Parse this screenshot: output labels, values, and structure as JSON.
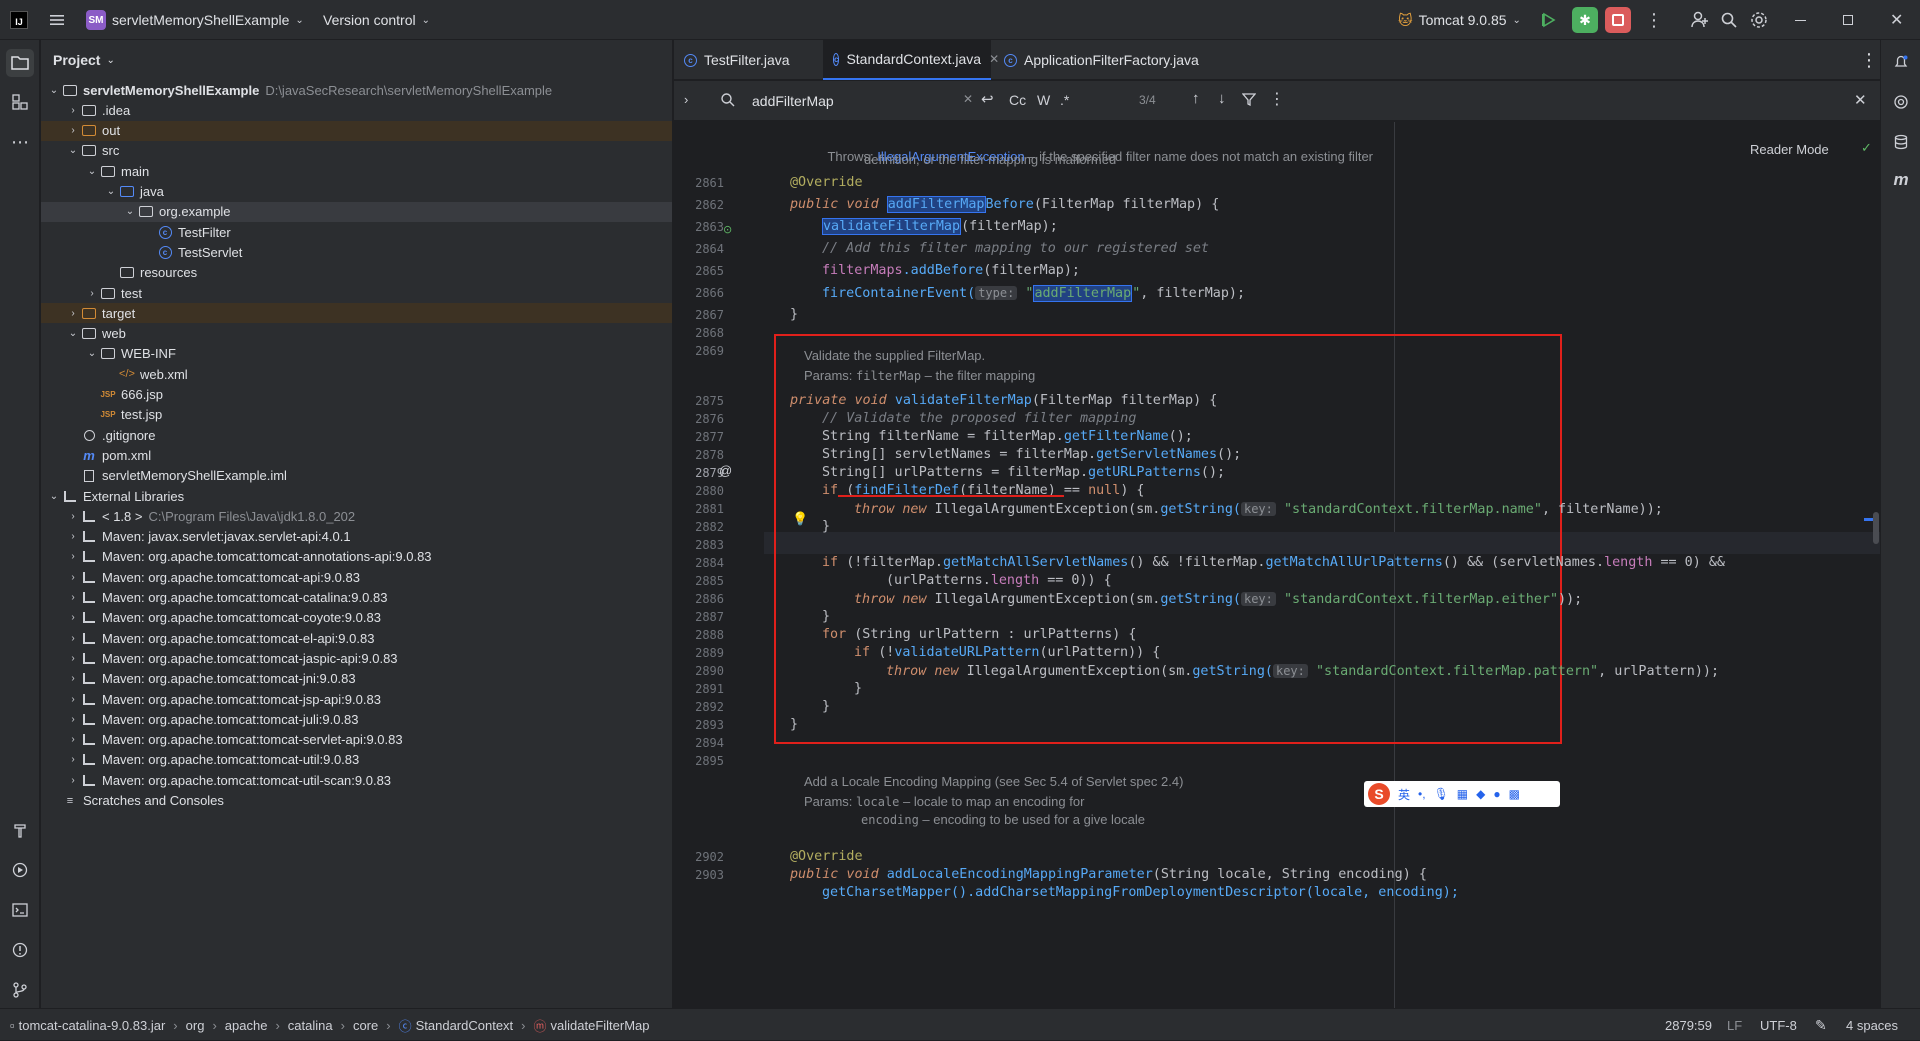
{
  "titlebar": {
    "project_badge": "SM",
    "project_name": "servletMemoryShellExample",
    "vcs": "Version control",
    "run_config": "Tomcat 9.0.85"
  },
  "project_panel": {
    "title": "Project",
    "tree": [
      {
        "label": "servletMemoryShellExample",
        "extra": "D:\\javaSecResearch\\servletMemoryShellExample",
        "depth": 0,
        "arrow": "down",
        "icon": "module",
        "bold": true
      },
      {
        "label": ".idea",
        "depth": 1,
        "arrow": "right",
        "icon": "folder"
      },
      {
        "label": "out",
        "depth": 1,
        "arrow": "right",
        "icon": "folder-orange",
        "excluded": true
      },
      {
        "label": "src",
        "depth": 1,
        "arrow": "down",
        "icon": "folder"
      },
      {
        "label": "main",
        "depth": 2,
        "arrow": "down",
        "icon": "folder"
      },
      {
        "label": "java",
        "depth": 3,
        "arrow": "down",
        "icon": "folder-blue"
      },
      {
        "label": "org.example",
        "depth": 4,
        "arrow": "down",
        "icon": "package",
        "selected": true
      },
      {
        "label": "TestFilter",
        "depth": 5,
        "arrow": "",
        "icon": "class"
      },
      {
        "label": "TestServlet",
        "depth": 5,
        "arrow": "",
        "icon": "class"
      },
      {
        "label": "resources",
        "depth": 3,
        "arrow": "",
        "icon": "folder"
      },
      {
        "label": "test",
        "depth": 2,
        "arrow": "right",
        "icon": "folder"
      },
      {
        "label": "target",
        "depth": 1,
        "arrow": "right",
        "icon": "folder-orange",
        "excluded": true
      },
      {
        "label": "web",
        "depth": 1,
        "arrow": "down",
        "icon": "folder"
      },
      {
        "label": "WEB-INF",
        "depth": 2,
        "arrow": "down",
        "icon": "folder"
      },
      {
        "label": "web.xml",
        "depth": 3,
        "arrow": "",
        "icon": "xml"
      },
      {
        "label": "666.jsp",
        "depth": 2,
        "arrow": "",
        "icon": "jsp"
      },
      {
        "label": "test.jsp",
        "depth": 2,
        "arrow": "",
        "icon": "jsp"
      },
      {
        "label": ".gitignore",
        "depth": 1,
        "arrow": "",
        "icon": "ignore"
      },
      {
        "label": "pom.xml",
        "depth": 1,
        "arrow": "",
        "icon": "maven"
      },
      {
        "label": "servletMemoryShellExample.iml",
        "depth": 1,
        "arrow": "",
        "icon": "file"
      },
      {
        "label": "External Libraries",
        "depth": 0,
        "arrow": "down",
        "icon": "library"
      },
      {
        "label": "< 1.8 >",
        "extra": "C:\\Program Files\\Java\\jdk1.8.0_202",
        "depth": 1,
        "arrow": "right",
        "icon": "library"
      },
      {
        "label": "Maven: javax.servlet:javax.servlet-api:4.0.1",
        "depth": 1,
        "arrow": "right",
        "icon": "library"
      },
      {
        "label": "Maven: org.apache.tomcat:tomcat-annotations-api:9.0.83",
        "depth": 1,
        "arrow": "right",
        "icon": "library"
      },
      {
        "label": "Maven: org.apache.tomcat:tomcat-api:9.0.83",
        "depth": 1,
        "arrow": "right",
        "icon": "library"
      },
      {
        "label": "Maven: org.apache.tomcat:tomcat-catalina:9.0.83",
        "depth": 1,
        "arrow": "right",
        "icon": "library"
      },
      {
        "label": "Maven: org.apache.tomcat:tomcat-coyote:9.0.83",
        "depth": 1,
        "arrow": "right",
        "icon": "library"
      },
      {
        "label": "Maven: org.apache.tomcat:tomcat-el-api:9.0.83",
        "depth": 1,
        "arrow": "right",
        "icon": "library"
      },
      {
        "label": "Maven: org.apache.tomcat:tomcat-jaspic-api:9.0.83",
        "depth": 1,
        "arrow": "right",
        "icon": "library"
      },
      {
        "label": "Maven: org.apache.tomcat:tomcat-jni:9.0.83",
        "depth": 1,
        "arrow": "right",
        "icon": "library"
      },
      {
        "label": "Maven: org.apache.tomcat:tomcat-jsp-api:9.0.83",
        "depth": 1,
        "arrow": "right",
        "icon": "library"
      },
      {
        "label": "Maven: org.apache.tomcat:tomcat-juli:9.0.83",
        "depth": 1,
        "arrow": "right",
        "icon": "library"
      },
      {
        "label": "Maven: org.apache.tomcat:tomcat-servlet-api:9.0.83",
        "depth": 1,
        "arrow": "right",
        "icon": "library"
      },
      {
        "label": "Maven: org.apache.tomcat:tomcat-util:9.0.83",
        "depth": 1,
        "arrow": "right",
        "icon": "library"
      },
      {
        "label": "Maven: org.apache.tomcat:tomcat-util-scan:9.0.83",
        "depth": 1,
        "arrow": "right",
        "icon": "library"
      },
      {
        "label": "Scratches and Consoles",
        "depth": 0,
        "arrow": "",
        "icon": "scratch"
      }
    ]
  },
  "tabs": [
    {
      "label": "TestFilter.java",
      "active": false
    },
    {
      "label": "StandardContext.java",
      "active": true
    },
    {
      "label": "ApplicationFilterFactory.java",
      "active": false
    }
  ],
  "find": {
    "query": "addFilterMap",
    "match_case": "Cc",
    "words": "W",
    "regex": ".*",
    "count": "3/4"
  },
  "reader_mode": "Reader Mode",
  "doc_top": {
    "throws_label": "Throws:",
    "throws_type": "IllegalArgumentException",
    "throws_text1": " – if the specified filter name does not match an existing filter",
    "throws_text2": "definition, or the filter mapping is malformed"
  },
  "doc_validate": {
    "line1": "Validate the supplied FilterMap.",
    "params_label": "Params:",
    "param_name": "filterMap",
    "param_text": " – the filter mapping"
  },
  "doc_locale": {
    "line1": "Add a Locale Encoding Mapping (see Sec 5.4 of Servlet spec 2.4)",
    "params_label": "Params:",
    "p1_name": "locale",
    "p1_text": " – locale to map an encoding for",
    "p2_name": "encoding",
    "p2_text": " – encoding to be used for a give locale"
  },
  "line_numbers": [
    "2861",
    "2862",
    "2863",
    "2864",
    "2865",
    "2866",
    "2867",
    "2868",
    "2869",
    "2875",
    "2876",
    "2877",
    "2878",
    "2879",
    "2880",
    "2881",
    "2882",
    "2883",
    "2884",
    "2885",
    "2886",
    "2887",
    "2888",
    "2889",
    "2890",
    "2891",
    "2892",
    "2893",
    "2894",
    "2895",
    "2902",
    "2903"
  ],
  "current_line": "2879",
  "code": {
    "override1": "@Override",
    "sig1_kw": "public void ",
    "sig1_fn_hl": "addFilterMap",
    "sig1_fn_rest": "Before",
    "sig1_rest": "(FilterMap filterMap) {",
    "l2863_call": "validateFilterMap",
    "l2863_rest": "(filterMap);",
    "l2864": "// Add this filter mapping to our registered set",
    "l2865_field": "filterMaps",
    "l2865_method": ".addBefore",
    "l2865_rest": "(filterMap);",
    "l2866_call": "fireContainerEvent(",
    "l2866_hint": "type:",
    "l2866_q1": " \"",
    "l2866_str": "addFilterMap",
    "l2866_q2": "\"",
    "l2866_rest": ", filterMap);",
    "close": "}",
    "sig2_kw": "private void ",
    "sig2_fn": "validateFilterMap",
    "sig2_rest": "(FilterMap filterMap) {",
    "l2876": "// Validate the proposed filter mapping",
    "l2877_a": "String filterName = filterMap.",
    "l2877_m": "getFilterName",
    "l2877_b": "();",
    "l2878_a": "String[] servletNames = filterMap.",
    "l2878_m": "getServletNames",
    "l2878_b": "();",
    "l2879_a": "String[] urlPatterns = filterMap.",
    "l2879_m": "getURLPatterns",
    "l2879_b": "();",
    "l2880_if": "if ",
    "l2880_a": "(",
    "l2880_m": "findFilterDef",
    "l2880_b": "(filterName) == ",
    "l2880_null": "null",
    "l2880_c": ") {",
    "throw_kw": "throw new ",
    "l2881_a": "IllegalArgumentException(sm.",
    "getstring": "getString(",
    "key_hint": "key:",
    "l2881_str": " \"standardContext.filterMap.name\"",
    "l2881_b": ", filterName));",
    "l2884_if": "if ",
    "l2884_a": "(!filterMap.",
    "l2884_m1": "getMatchAllServletNames",
    "l2884_b": "() && !filterMap.",
    "l2884_m2": "getMatchAllUrlPatterns",
    "l2884_c": "() && (servletNames.",
    "length": "length",
    "l2884_d": " == 0) &&",
    "l2885_a": "(urlPatterns.",
    "l2885_b": " == 0)) {",
    "l2886_str": " \"standardContext.filterMap.either\"",
    "l2886_b": "));",
    "for_kw": "for ",
    "l2888_rest": "(String urlPattern : urlPatterns) {",
    "l2889_if": "if ",
    "l2889_a": "(!",
    "l2889_m": "validateURLPattern",
    "l2889_b": "(urlPattern)) {",
    "l2890_str": " \"standardContext.filterMap.pattern\"",
    "l2890_b": ", urlPattern));",
    "override2": "@Override",
    "sig3_kw": "public void ",
    "sig3_fn": "addLocaleEncodingMappingParameter",
    "sig3_rest": "(String locale, String encoding) {",
    "l2904_cut": "getCharsetMapper().addCharsetMappingFromDeploymentDescriptor(locale, encoding);"
  },
  "ime": "英",
  "statusbar": {
    "breadcrumbs": [
      "tomcat-catalina-9.0.83.jar",
      "org",
      "apache",
      "catalina",
      "core",
      "StandardContext",
      "validateFilterMap"
    ],
    "position": "2879:59",
    "line_sep": "LF",
    "encoding": "UTF-8",
    "indent": "4 spaces"
  },
  "colors": {
    "accent": "#3574f0",
    "highlight_box": "#e0201b",
    "run_green": "#4daf60",
    "stop_red": "#db5c5c"
  }
}
